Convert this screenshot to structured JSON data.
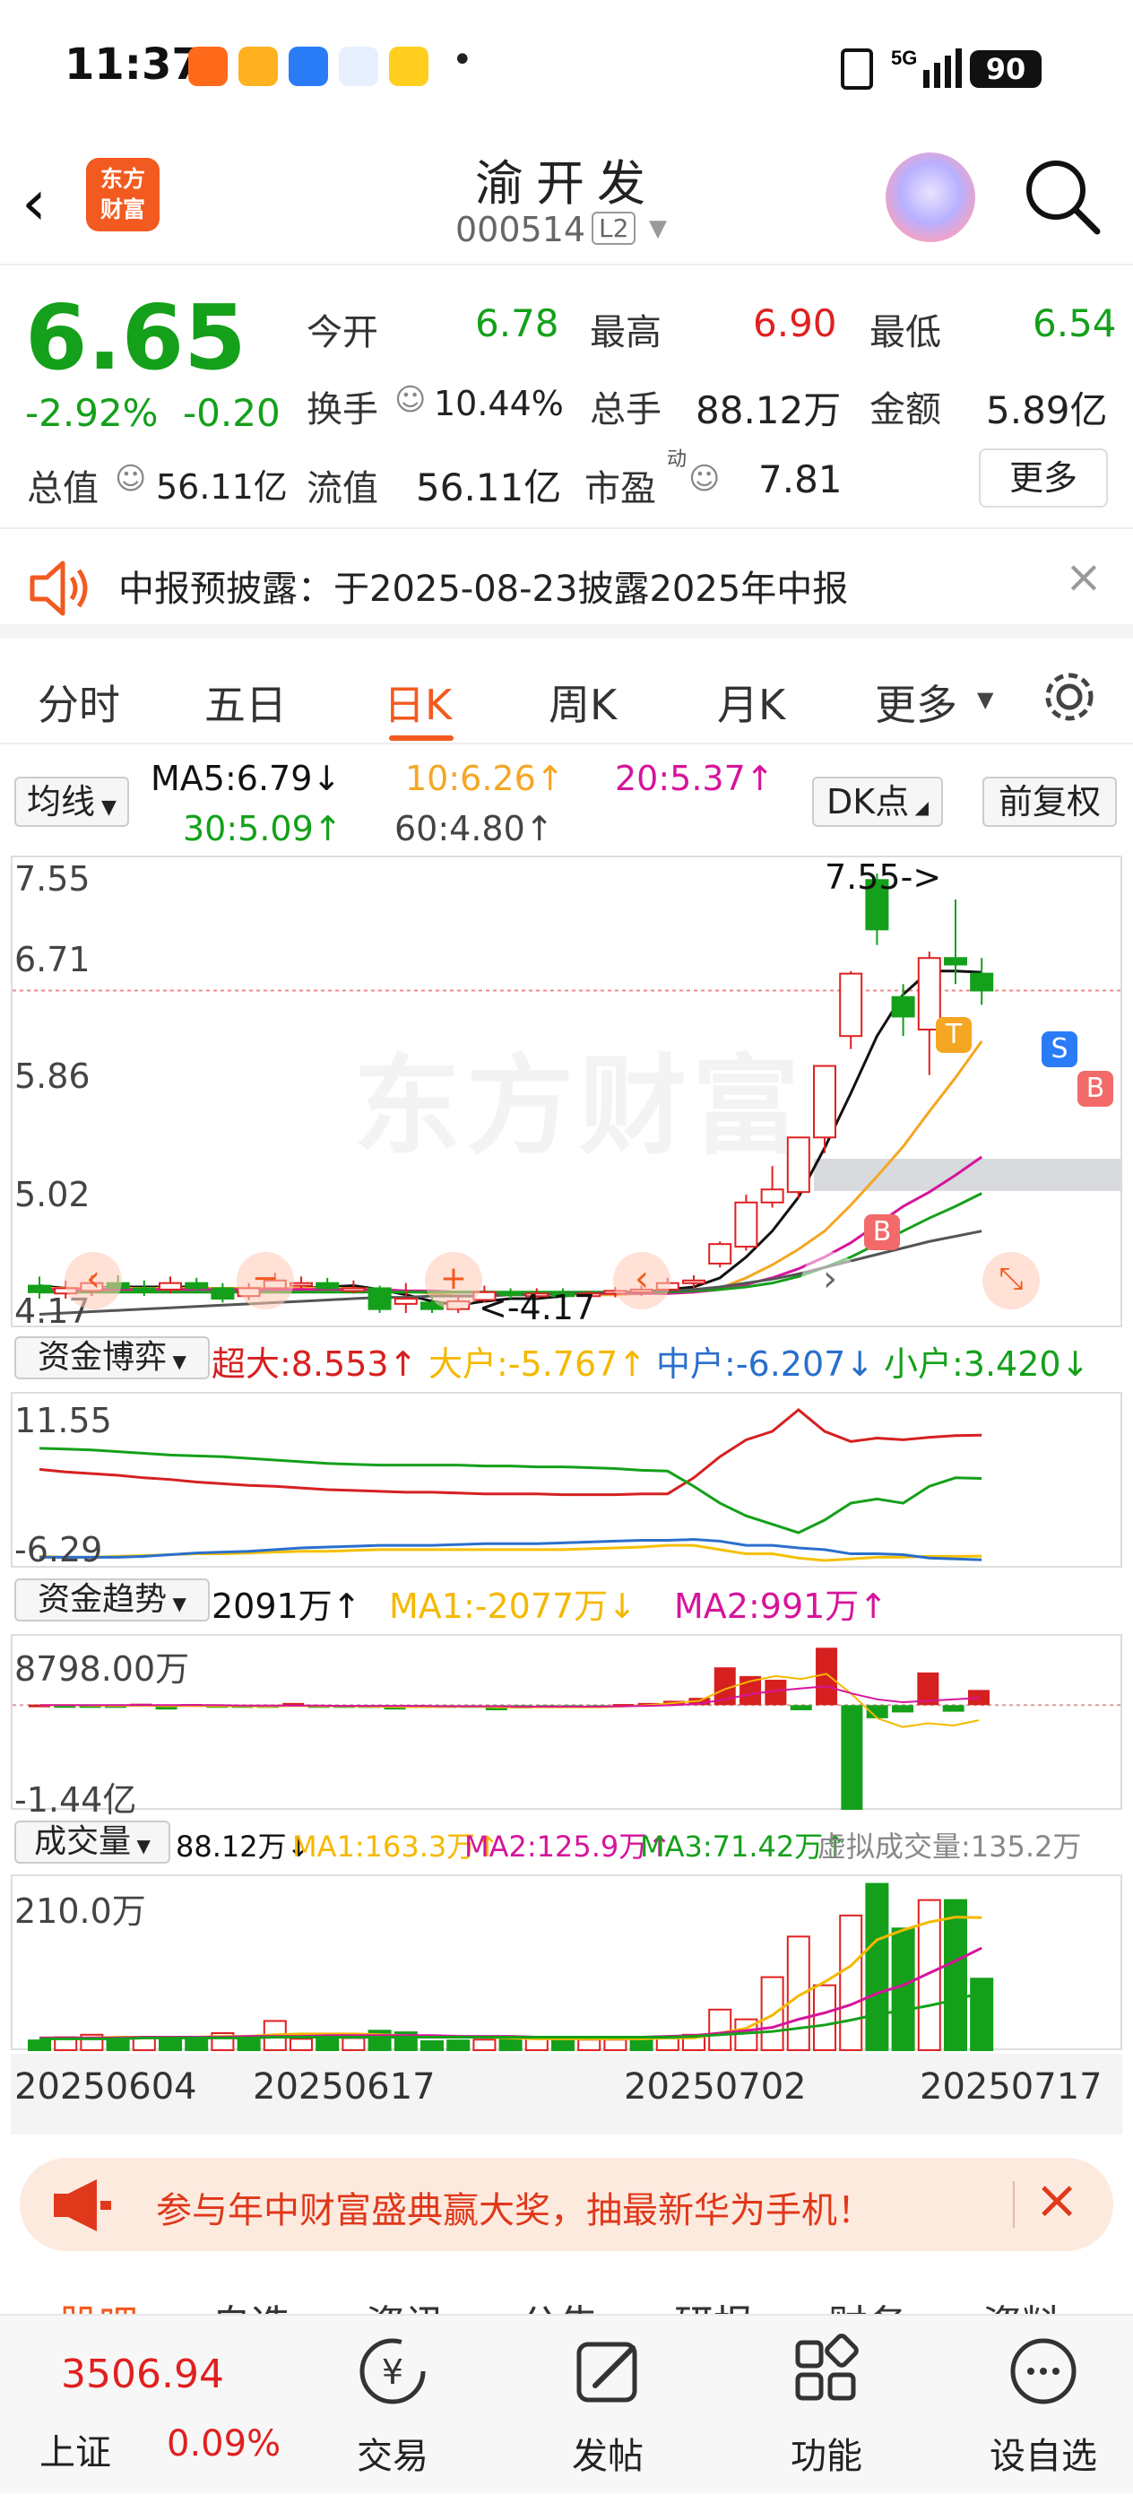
{
  "status": {
    "time": "11:37",
    "battery": "90",
    "signal": "5G"
  },
  "header": {
    "name": "渝开发",
    "code": "000514",
    "level": "L2",
    "logo_line1": "东方",
    "logo_line2": "财富"
  },
  "quote": {
    "price": "6.65",
    "change_pct": "-2.92%",
    "change": "-0.20",
    "open_label": "今开",
    "open": "6.78",
    "high_label": "最高",
    "high": "6.90",
    "low_label": "最低",
    "low": "6.54",
    "turnover_label": "换手",
    "turnover": "10.44%",
    "volume_label": "总手",
    "volume": "88.12万",
    "amount_label": "金额",
    "amount": "5.89亿",
    "mktcap_label": "总值",
    "mktcap": "56.11亿",
    "float_label": "流值",
    "float_cap": "56.11亿",
    "pe_label": "市盈",
    "pe_sup": "动",
    "pe": "7.81",
    "more": "更多"
  },
  "notice": {
    "text": "中报预披露：于2025-08-23披露2025年中报"
  },
  "tabs": [
    "分时",
    "五日",
    "日K",
    "周K",
    "月K",
    "更多"
  ],
  "active_tab": 2,
  "ma": {
    "selector": "均线",
    "ma5": "MA5:6.79↓",
    "ma10": "10:6.26↑",
    "ma20": "20:5.37↑",
    "ma30": "30:5.09↑",
    "ma60": "60:4.80↑",
    "dk": "DK点",
    "adjust": "前复权"
  },
  "kline": {
    "y_top": "7.55",
    "y_2": "6.71",
    "y_3": "5.86",
    "y_4": "5.02",
    "y_bottom": "4.17",
    "max_label": "7.55->",
    "min_label": "<-4.17",
    "watermark": "东方财富",
    "marker_t": "T",
    "marker_s": "S",
    "marker_b": "B"
  },
  "flow": {
    "selector": "资金博弈",
    "super": "超大:8.553↑",
    "large": "大户:-5.767↑",
    "mid": "中户:-6.207↓",
    "small": "小户:3.420↓",
    "y_top": "11.55",
    "y_bottom": "-6.29"
  },
  "trend": {
    "selector": "资金趋势",
    "value": "2091万↑",
    "ma1": "MA1:-2077万↓",
    "ma2": "MA2:991万↑",
    "y_top": "8798.00万",
    "y_bottom": "-1.44亿"
  },
  "vol": {
    "selector": "成交量",
    "value": "88.12万↓",
    "ma1": "MA1:163.3万↑",
    "ma2": "MA2:125.9万↑",
    "ma3": "MA3:71.42万↑",
    "virtual": "虚拟成交量:135.2万",
    "y_top": "210.0万"
  },
  "dates": [
    "20250604",
    "20250617",
    "20250702",
    "20250717"
  ],
  "banner": {
    "text": "参与年中财富盛典赢大奖，抽最新华为手机！"
  },
  "subtabs": [
    "股吧",
    "自选",
    "资讯",
    "公告",
    "研报",
    "财务",
    "资料"
  ],
  "index": {
    "value": "3506.94",
    "name": "上证",
    "pct": "0.09%"
  },
  "bottom_nav": [
    "交易",
    "发帖",
    "功能",
    "设自选"
  ],
  "colors": {
    "up": "#e02020",
    "down": "#14a01a",
    "brand": "#f25a1f"
  },
  "chart_data": [
    {
      "type": "candlestick",
      "title": "日K",
      "ylim": [
        4.17,
        7.55
      ],
      "candles": [
        {
          "o": 4.38,
          "c": 4.33,
          "h": 4.45,
          "l": 4.28
        },
        {
          "o": 4.32,
          "c": 4.36,
          "h": 4.42,
          "l": 4.28
        },
        {
          "o": 4.34,
          "c": 4.4,
          "h": 4.46,
          "l": 4.3
        },
        {
          "o": 4.4,
          "c": 4.36,
          "h": 4.46,
          "l": 4.32
        },
        {
          "o": 4.36,
          "c": 4.35,
          "h": 4.42,
          "l": 4.3
        },
        {
          "o": 4.35,
          "c": 4.4,
          "h": 4.45,
          "l": 4.32
        },
        {
          "o": 4.4,
          "c": 4.36,
          "h": 4.44,
          "l": 4.32
        },
        {
          "o": 4.36,
          "c": 4.28,
          "h": 4.4,
          "l": 4.25
        },
        {
          "o": 4.3,
          "c": 4.36,
          "h": 4.4,
          "l": 4.27
        },
        {
          "o": 4.36,
          "c": 4.42,
          "h": 4.48,
          "l": 4.33
        },
        {
          "o": 4.4,
          "c": 4.4,
          "h": 4.45,
          "l": 4.36
        },
        {
          "o": 4.4,
          "c": 4.36,
          "h": 4.44,
          "l": 4.33
        },
        {
          "o": 4.36,
          "c": 4.36,
          "h": 4.42,
          "l": 4.32
        },
        {
          "o": 4.36,
          "c": 4.2,
          "h": 4.38,
          "l": 4.17
        },
        {
          "o": 4.24,
          "c": 4.28,
          "h": 4.4,
          "l": 4.17
        },
        {
          "o": 4.25,
          "c": 4.2,
          "h": 4.3,
          "l": 4.17
        },
        {
          "o": 4.2,
          "c": 4.26,
          "h": 4.3,
          "l": 4.17
        },
        {
          "o": 4.27,
          "c": 4.33,
          "h": 4.38,
          "l": 4.25
        },
        {
          "o": 4.33,
          "c": 4.31,
          "h": 4.36,
          "l": 4.28
        },
        {
          "o": 4.31,
          "c": 4.32,
          "h": 4.36,
          "l": 4.28
        },
        {
          "o": 4.32,
          "c": 4.3,
          "h": 4.36,
          "l": 4.27
        },
        {
          "o": 4.3,
          "c": 4.32,
          "h": 4.34,
          "l": 4.28
        },
        {
          "o": 4.32,
          "c": 4.34,
          "h": 4.37,
          "l": 4.29
        },
        {
          "o": 4.34,
          "c": 4.35,
          "h": 4.38,
          "l": 4.3
        },
        {
          "o": 4.35,
          "c": 4.4,
          "h": 4.44,
          "l": 4.32
        },
        {
          "o": 4.4,
          "c": 4.42,
          "h": 4.46,
          "l": 4.36
        },
        {
          "o": 4.55,
          "c": 4.7,
          "h": 4.72,
          "l": 4.52
        },
        {
          "o": 4.68,
          "c": 5.02,
          "h": 5.08,
          "l": 4.65
        },
        {
          "o": 5.02,
          "c": 5.12,
          "h": 5.3,
          "l": 4.98
        },
        {
          "o": 5.1,
          "c": 5.52,
          "h": 5.52,
          "l": 5.05
        },
        {
          "o": 5.52,
          "c": 6.07,
          "h": 6.07,
          "l": 5.4
        },
        {
          "o": 6.3,
          "c": 6.78,
          "h": 6.8,
          "l": 6.2
        },
        {
          "o": 7.5,
          "c": 7.12,
          "h": 7.55,
          "l": 7.0
        },
        {
          "o": 6.6,
          "c": 6.45,
          "h": 6.7,
          "l": 6.3
        },
        {
          "o": 6.35,
          "c": 6.9,
          "h": 6.95,
          "l": 6.0
        },
        {
          "o": 6.9,
          "c": 6.85,
          "h": 7.35,
          "l": 6.7
        },
        {
          "o": 6.78,
          "c": 6.65,
          "h": 6.9,
          "l": 6.54
        }
      ],
      "ma_series": [
        {
          "name": "MA5",
          "color": "#111111",
          "values": [
            4.38,
            4.36,
            4.36,
            4.37,
            4.37,
            4.37,
            4.37,
            4.35,
            4.35,
            4.35,
            4.36,
            4.37,
            4.38,
            4.35,
            4.31,
            4.26,
            4.23,
            4.26,
            4.28,
            4.28,
            4.3,
            4.32,
            4.32,
            4.33,
            4.35,
            4.37,
            4.44,
            4.6,
            4.8,
            5.06,
            5.44,
            5.86,
            6.3,
            6.62,
            6.8,
            6.8,
            6.79
          ]
        },
        {
          "name": "MA10",
          "color": "#f5a623",
          "values": [
            4.36,
            4.36,
            4.36,
            4.36,
            4.36,
            4.36,
            4.36,
            4.36,
            4.36,
            4.36,
            4.36,
            4.36,
            4.36,
            4.35,
            4.34,
            4.32,
            4.3,
            4.3,
            4.31,
            4.31,
            4.31,
            4.31,
            4.31,
            4.32,
            4.32,
            4.33,
            4.36,
            4.44,
            4.54,
            4.66,
            4.8,
            5.0,
            5.22,
            5.45,
            5.72,
            5.98,
            6.26
          ]
        },
        {
          "name": "MA20",
          "color": "#d6149b",
          "values": [
            4.35,
            4.35,
            4.35,
            4.35,
            4.35,
            4.35,
            4.35,
            4.35,
            4.35,
            4.35,
            4.35,
            4.35,
            4.35,
            4.35,
            4.34,
            4.34,
            4.33,
            4.33,
            4.32,
            4.32,
            4.32,
            4.32,
            4.32,
            4.32,
            4.32,
            4.33,
            4.35,
            4.39,
            4.44,
            4.51,
            4.6,
            4.71,
            4.85,
            4.99,
            5.1,
            5.23,
            5.37
          ]
        },
        {
          "name": "MA30",
          "color": "#14a01a",
          "values": [
            4.33,
            4.33,
            4.33,
            4.33,
            4.33,
            4.33,
            4.33,
            4.33,
            4.33,
            4.33,
            4.33,
            4.33,
            4.33,
            4.33,
            4.33,
            4.33,
            4.33,
            4.33,
            4.33,
            4.33,
            4.33,
            4.33,
            4.33,
            4.33,
            4.33,
            4.34,
            4.35,
            4.37,
            4.4,
            4.45,
            4.52,
            4.6,
            4.7,
            4.8,
            4.9,
            4.99,
            5.09
          ]
        },
        {
          "name": "MA60",
          "color": "#555555",
          "values": [
            4.16,
            4.17,
            4.18,
            4.19,
            4.2,
            4.21,
            4.22,
            4.23,
            4.24,
            4.25,
            4.26,
            4.27,
            4.28,
            4.29,
            4.29,
            4.3,
            4.3,
            4.3,
            4.31,
            4.31,
            4.32,
            4.32,
            4.33,
            4.33,
            4.34,
            4.35,
            4.37,
            4.4,
            4.43,
            4.47,
            4.52,
            4.57,
            4.62,
            4.67,
            4.72,
            4.76,
            4.8
          ]
        }
      ]
    },
    {
      "type": "line",
      "title": "资金博弈",
      "ylim": [
        -6.29,
        11.55
      ],
      "series": [
        {
          "name": "超大",
          "color": "#d62020",
          "values": [
            4.5,
            4.2,
            4.0,
            3.8,
            3.5,
            3.3,
            3.0,
            2.8,
            2.6,
            2.5,
            2.3,
            2.1,
            2.0,
            1.9,
            1.8,
            1.8,
            1.7,
            1.6,
            1.6,
            1.6,
            1.5,
            1.5,
            1.5,
            1.6,
            1.6,
            3.5,
            6.0,
            8.0,
            9.0,
            11.55,
            9.0,
            7.8,
            8.2,
            8.0,
            8.3,
            8.5,
            8.55
          ]
        },
        {
          "name": "大户",
          "color": "#f5c000",
          "values": [
            -5.8,
            -5.9,
            -5.9,
            -5.8,
            -5.7,
            -5.6,
            -5.5,
            -5.5,
            -5.4,
            -5.3,
            -5.2,
            -5.2,
            -5.1,
            -5.0,
            -5.0,
            -5.0,
            -5.0,
            -5.0,
            -5.0,
            -5.0,
            -5.0,
            -4.9,
            -4.8,
            -4.7,
            -4.5,
            -4.5,
            -5.0,
            -5.5,
            -5.5,
            -6.0,
            -6.29,
            -6.1,
            -5.9,
            -5.9,
            -5.8,
            -5.8,
            -5.77
          ]
        },
        {
          "name": "中户",
          "color": "#2a6fcc",
          "values": [
            -5.9,
            -5.9,
            -5.9,
            -5.9,
            -5.8,
            -5.6,
            -5.4,
            -5.3,
            -5.2,
            -5.0,
            -4.8,
            -4.7,
            -4.6,
            -4.5,
            -4.5,
            -4.5,
            -4.4,
            -4.3,
            -4.3,
            -4.3,
            -4.2,
            -4.1,
            -4.0,
            -3.9,
            -3.9,
            -3.8,
            -4.0,
            -4.5,
            -4.5,
            -4.8,
            -5.0,
            -5.5,
            -5.5,
            -5.6,
            -6.0,
            -6.1,
            -6.21
          ]
        },
        {
          "name": "小户",
          "color": "#14a01a",
          "values": [
            7.0,
            6.9,
            6.8,
            6.6,
            6.4,
            6.2,
            6.1,
            6.0,
            5.8,
            5.6,
            5.4,
            5.2,
            5.1,
            5.0,
            5.0,
            5.0,
            5.0,
            4.9,
            4.9,
            4.8,
            4.8,
            4.7,
            4.6,
            4.4,
            4.3,
            2.5,
            0.5,
            -1.0,
            -2.0,
            -3.0,
            -1.5,
            0.5,
            1.0,
            0.5,
            2.5,
            3.5,
            3.42
          ]
        }
      ]
    },
    {
      "type": "bar",
      "title": "资金趋势",
      "ylim": [
        -14400,
        8798
      ],
      "unit": "万",
      "values": [
        80,
        -100,
        -120,
        -300,
        200,
        -600,
        150,
        -300,
        -250,
        -200,
        300,
        -200,
        -150,
        -200,
        -600,
        -250,
        -200,
        -150,
        -700,
        -450,
        -300,
        -250,
        -300,
        150,
        300,
        600,
        1000,
        5200,
        4000,
        3500,
        -700,
        7900,
        -14400,
        -1800,
        -1000,
        4500,
        -900,
        2091
      ],
      "ma1_values": [
        0,
        0,
        -50,
        -100,
        -50,
        -150,
        -100,
        -150,
        -150,
        -200,
        -100,
        -150,
        -150,
        -200,
        -250,
        -250,
        -250,
        -200,
        -300,
        -300,
        -300,
        -300,
        -300,
        -200,
        0,
        300,
        600,
        2200,
        3300,
        4000,
        3600,
        4300,
        1500,
        -1800,
        -3000,
        -2500,
        -2800,
        -2077
      ],
      "ma2_values": [
        0,
        0,
        0,
        0,
        0,
        0,
        0,
        0,
        -50,
        -50,
        -50,
        -50,
        -100,
        -100,
        -100,
        -100,
        -150,
        -150,
        -150,
        -200,
        -200,
        -200,
        -200,
        -150,
        -100,
        0,
        200,
        800,
        1500,
        2000,
        2300,
        2600,
        1600,
        800,
        400,
        600,
        800,
        991
      ]
    },
    {
      "type": "bar",
      "title": "成交量",
      "ylim": [
        0,
        210
      ],
      "unit": "万",
      "values": [
        12,
        16,
        19,
        14,
        16,
        14,
        13,
        21,
        15,
        36,
        14,
        17,
        15,
        24,
        22,
        11,
        12,
        13,
        13,
        14,
        15,
        13,
        13,
        16,
        17,
        19,
        50,
        38,
        90,
        140,
        80,
        166,
        205,
        150,
        185,
        185,
        88.12
      ],
      "up": [
        false,
        true,
        true,
        false,
        true,
        false,
        false,
        true,
        false,
        true,
        true,
        false,
        true,
        false,
        false,
        false,
        false,
        true,
        false,
        true,
        false,
        true,
        true,
        false,
        true,
        true,
        true,
        true,
        true,
        true,
        true,
        true,
        false,
        false,
        true,
        false,
        false
      ],
      "ma1_values": [
        15,
        15,
        15,
        16,
        16,
        16,
        16,
        17,
        17,
        19,
        20,
        20,
        20,
        19,
        18,
        17,
        16,
        16,
        15,
        14,
        14,
        14,
        14,
        14,
        15,
        15,
        21,
        27,
        43,
        67,
        84,
        104,
        136,
        148,
        158,
        164,
        163.3
      ],
      "ma2_values": [
        15,
        15,
        15,
        15,
        16,
        16,
        16,
        16,
        17,
        17,
        17,
        18,
        18,
        18,
        18,
        18,
        17,
        17,
        17,
        16,
        16,
        16,
        16,
        16,
        17,
        18,
        21,
        24,
        28,
        38,
        46,
        56,
        70,
        80,
        95,
        110,
        125.9
      ],
      "ma3_values": [
        14,
        14,
        14,
        14,
        15,
        15,
        15,
        15,
        15,
        16,
        16,
        16,
        16,
        16,
        16,
        16,
        16,
        16,
        16,
        16,
        16,
        16,
        16,
        16,
        16,
        17,
        19,
        21,
        23,
        27,
        31,
        37,
        44,
        49,
        55,
        62,
        71.42
      ]
    }
  ]
}
